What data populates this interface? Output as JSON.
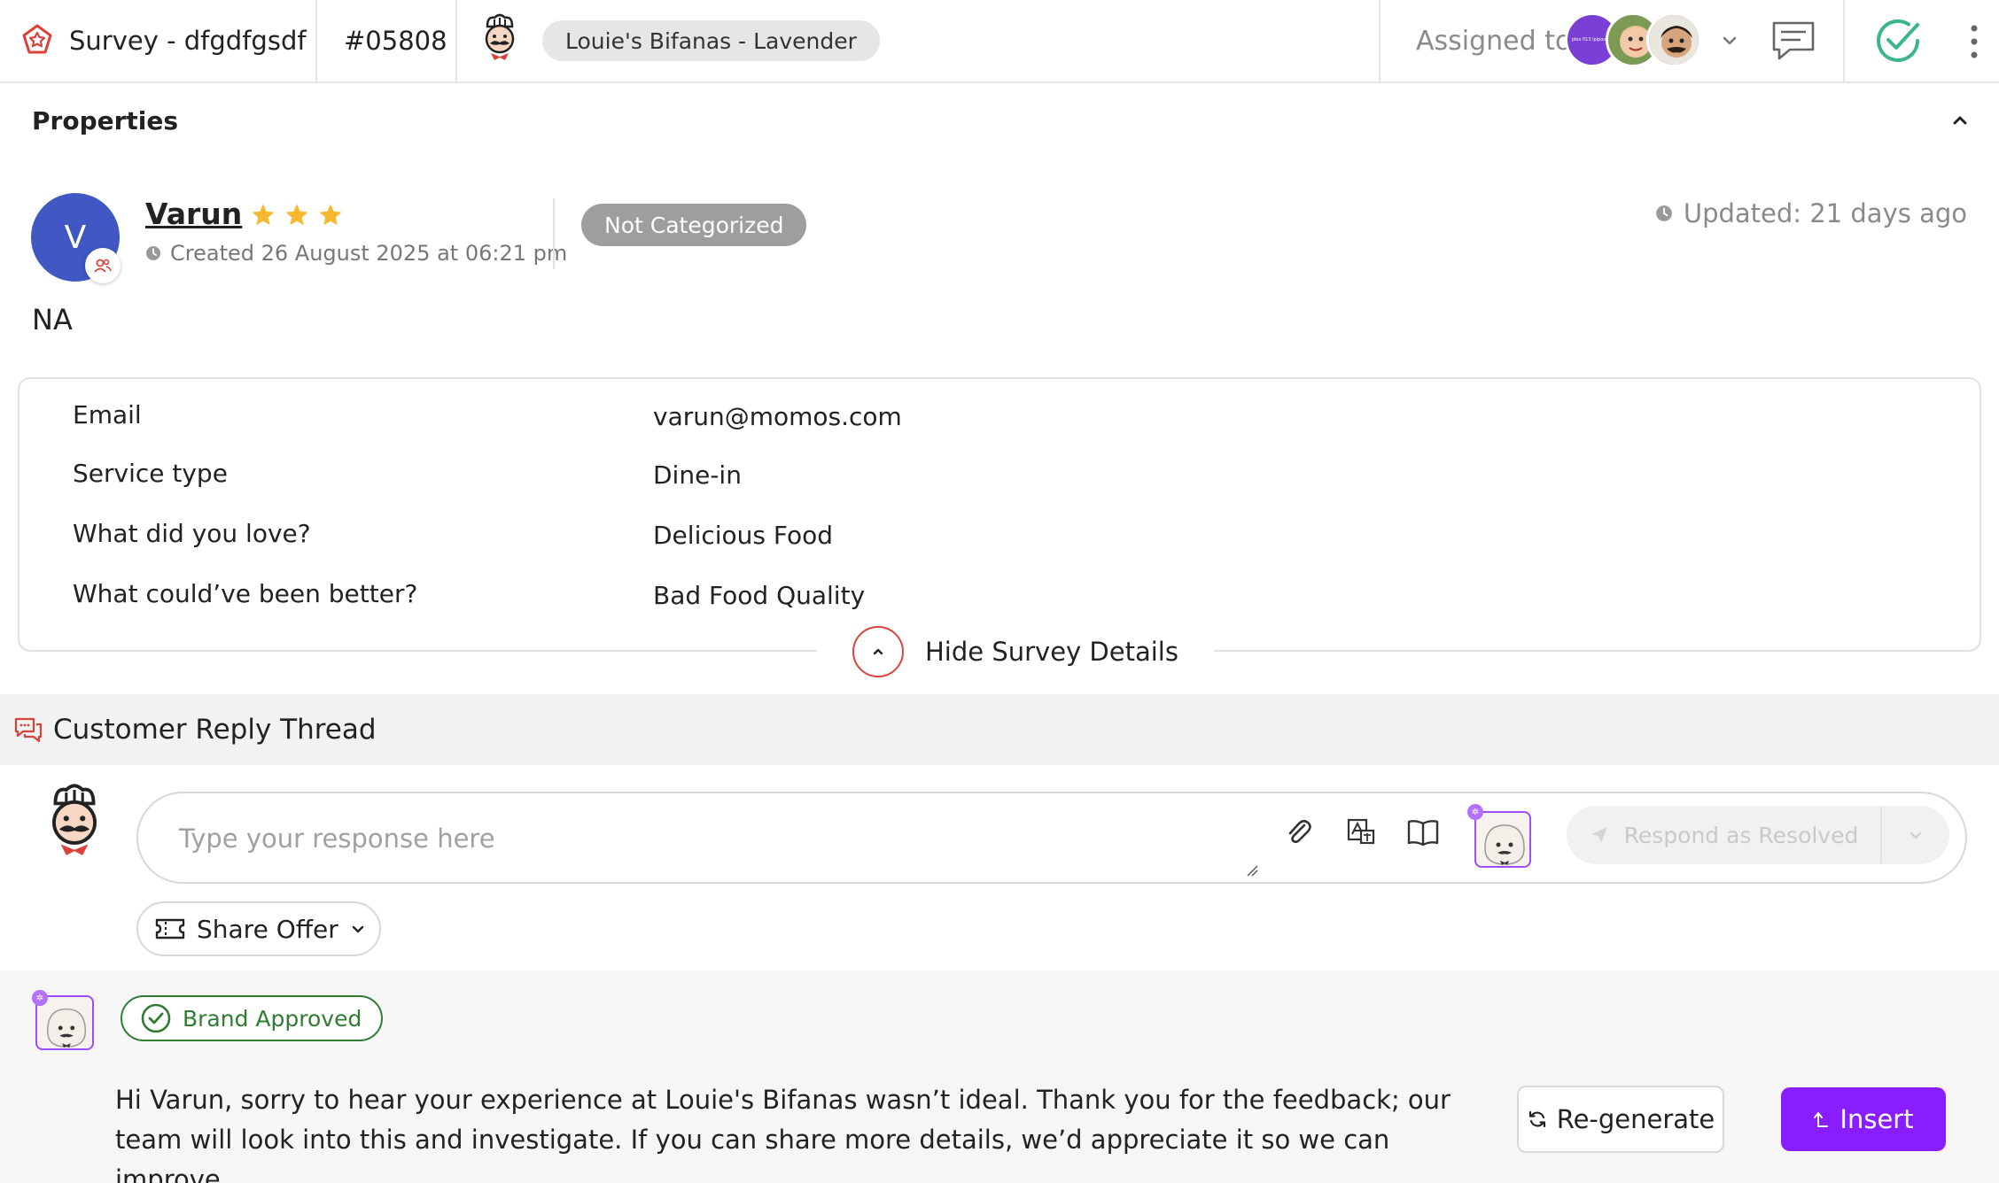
{
  "header": {
    "survey_title": "Survey - dfgdfgsdf",
    "ticket_id": "#05808",
    "brand_location": "Louie's Bifanas - Lavender",
    "assigned_label": "Assigned to",
    "assignee_avatar_text": "pleo fl13 lplpoo fl3",
    "icons": [
      "survey-icon",
      "chef-logo",
      "chevron-down-icon",
      "chat-icon",
      "check-circle-icon",
      "more-vertical-icon"
    ]
  },
  "properties": {
    "title": "Properties",
    "customer": {
      "initial": "V",
      "name": "Varun",
      "rating": 3,
      "created": "Created 26 August 2025 at 06:21 pm"
    },
    "category": "Not Categorized",
    "updated": "Updated: 21 days ago",
    "comment": "NA"
  },
  "survey_details": {
    "rows": [
      {
        "label": "Email",
        "value": "varun@momos.com"
      },
      {
        "label": "Service type",
        "value": "Dine-in"
      },
      {
        "label": "What did you love?",
        "value": "Delicious Food"
      },
      {
        "label": "What could’ve been better?",
        "value": "Bad Food Quality"
      }
    ],
    "toggle_label": "Hide Survey Details"
  },
  "thread": {
    "title": "Customer Reply Thread",
    "input_placeholder": "Type your response here",
    "respond_button": "Respond as Resolved",
    "share_offer": "Share Offer"
  },
  "ai_suggestion": {
    "badge": "Brand Approved",
    "text": "Hi Varun, sorry to hear your experience at Louie's Bifanas wasn’t ideal. Thank you for the feedback; our team will look into this and investigate. If you can share more details, we’d appreciate it so we can improve.",
    "regenerate_label": "Re-generate",
    "insert_label": "Insert"
  },
  "colors": {
    "accent_purple": "#8a1dff",
    "avatar_blue": "#4158c4",
    "approved_green": "#2e7d32",
    "check_teal": "#3bb58a",
    "star_gold": "#f5b82e",
    "brand_red": "#d9433a"
  }
}
